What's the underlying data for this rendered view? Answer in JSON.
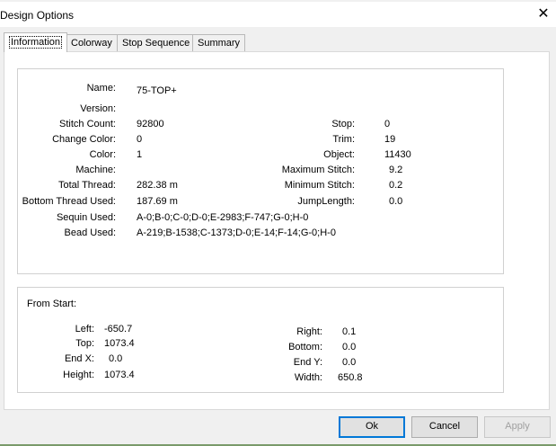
{
  "window": {
    "title": "Design Options",
    "close_glyph": "✕"
  },
  "tabs": [
    {
      "label": "Information"
    },
    {
      "label": "Colorway"
    },
    {
      "label": "Stop Sequence"
    },
    {
      "label": "Summary"
    }
  ],
  "info": {
    "name_label": "Name:",
    "name_value": "75-TOP+",
    "version_label": "Version:",
    "version_value": "",
    "stitch_count_label": "Stitch Count:",
    "stitch_count_value": "92800",
    "change_color_label": "Change Color:",
    "change_color_value": "0",
    "color_label": "Color:",
    "color_value": "1",
    "machine_label": "Machine:",
    "machine_value": "",
    "total_thread_label": "Total Thread:",
    "total_thread_value": "282.38 m",
    "bottom_thread_label": "Bottom Thread Used:",
    "bottom_thread_value": "187.69 m",
    "sequin_label": "Sequin Used:",
    "sequin_value": "A-0;B-0;C-0;D-0;E-2983;F-747;G-0;H-0",
    "bead_label": "Bead Used:",
    "bead_value": "A-219;B-1538;C-1373;D-0;E-14;F-14;G-0;H-0",
    "stop_label": "Stop:",
    "stop_value": "0",
    "trim_label": "Trim:",
    "trim_value": "19",
    "object_label": "Object:",
    "object_value": "11430",
    "max_stitch_label": "Maximum Stitch:",
    "max_stitch_value": "9.2",
    "min_stitch_label": "Minimum Stitch:",
    "min_stitch_value": "0.2",
    "jump_label": "JumpLength:",
    "jump_value": "0.0"
  },
  "from_start": {
    "heading": "From Start:",
    "left_label": "Left:",
    "left_value": "-650.7",
    "top_label": "Top:",
    "top_value": "1073.4",
    "endx_label": "End X:",
    "endx_value": "0.0",
    "height_label": "Height:",
    "height_value": "1073.4",
    "right_label": "Right:",
    "right_value": "0.1",
    "bottom_label": "Bottom:",
    "bottom_value": "0.0",
    "endy_label": "End Y:",
    "endy_value": "0.0",
    "width_label": "Width:",
    "width_value": "650.8"
  },
  "buttons": {
    "ok": "Ok",
    "cancel": "Cancel",
    "apply": "Apply"
  }
}
